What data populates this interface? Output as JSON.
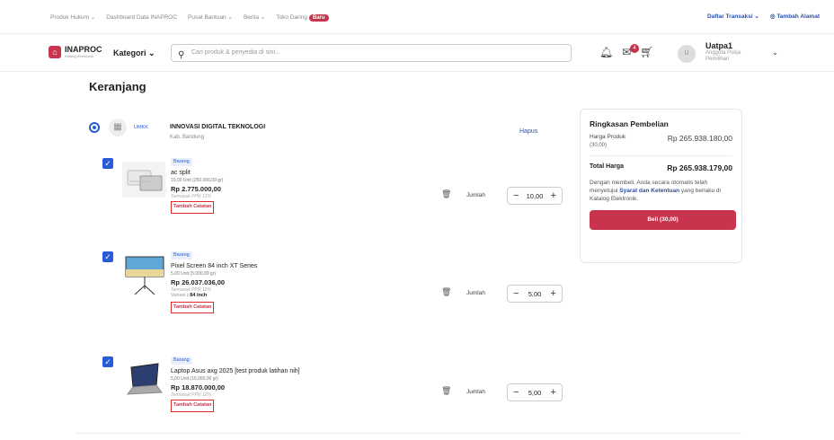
{
  "topbar": {
    "links": [
      "Produk Hukum",
      "Dashboard Data INAPROC",
      "Pusat Bantuan",
      "Berita",
      "Toko Daring"
    ],
    "badge": "Baru",
    "right_links": [
      "Daftar Transaksi",
      "Tambah Alamat"
    ]
  },
  "navbar": {
    "logo": "INAPROC",
    "logo_sub": "Katalog Elektronik",
    "kategori": "Kategori",
    "search_placeholder": "Cari produk & penyedia di sini...",
    "cart_count": "4",
    "avatar": "U",
    "user_name": "Uatpa1",
    "user_role": "Anggota Pokja Pemilihan"
  },
  "page_title": "Keranjang",
  "store": {
    "tag": "UMKK",
    "name": "INNOVASI DIGITAL TEKNOLOGI",
    "location": "Kab. Bandung",
    "delete": "Hapus"
  },
  "items": [
    {
      "tag": "Barang",
      "name": "ac split",
      "unit": "10,00 Unit (250.000,00 gr)",
      "price": "Rp 2.775.000,00",
      "ppn": "Termasuk PPN 12%",
      "variasi_label": "",
      "variasi_value": "",
      "note_btn": "Tambah Catatan",
      "qty_label": "Jumlah",
      "qty": "10,00"
    },
    {
      "tag": "Barang",
      "name": "Pixel Screen 84 inch XT Series",
      "unit": "5,00 Unit (5.000,00 gr)",
      "price": "Rp 26.037.036,00",
      "ppn": "Termasuk PPN 12%",
      "variasi_label": "Variasi",
      "variasi_value": ": 84 inch",
      "note_btn": "Tambah Catatan",
      "qty_label": "Jumlah",
      "qty": "5,00"
    },
    {
      "tag": "Barang",
      "name": "Laptop Asus axg 2025 [test produk latihan nih]",
      "unit": "5,00 Unit (15.000,00 gr)",
      "price": "Rp 18.870.000,00",
      "ppn": "Termasuk PPN 12%",
      "variasi_label": "",
      "variasi_value": "",
      "note_btn": "Tambah Catatan",
      "qty_label": "Jumlah",
      "qty": "5,00"
    }
  ],
  "summary": {
    "title": "Ringkasan Pembelian",
    "harga_label": "Harga Produk",
    "harga_qty": "(30,00)",
    "harga_value": "Rp 265.938.180,00",
    "total_label": "Total Harga",
    "total_value": "Rp 265.938.179,00",
    "note_pre": "Dengan membeli, Anda secara otomatis telah menyetujui",
    "note_link": "Syarat dan Ketentuan",
    "note_post": "yang berlaku di Katalog Elektronik.",
    "buy_label": "Beli (30,00)"
  },
  "colors": {
    "primary": "#c8344e",
    "accent_blue": "#2a5bd7",
    "highlight_border": "#e02b2b"
  },
  "icons": [
    "chevron-down-icon",
    "location-icon",
    "search-icon",
    "bell-icon",
    "mail-icon",
    "cart-icon",
    "store-icon",
    "trash-icon",
    "check-icon"
  ]
}
